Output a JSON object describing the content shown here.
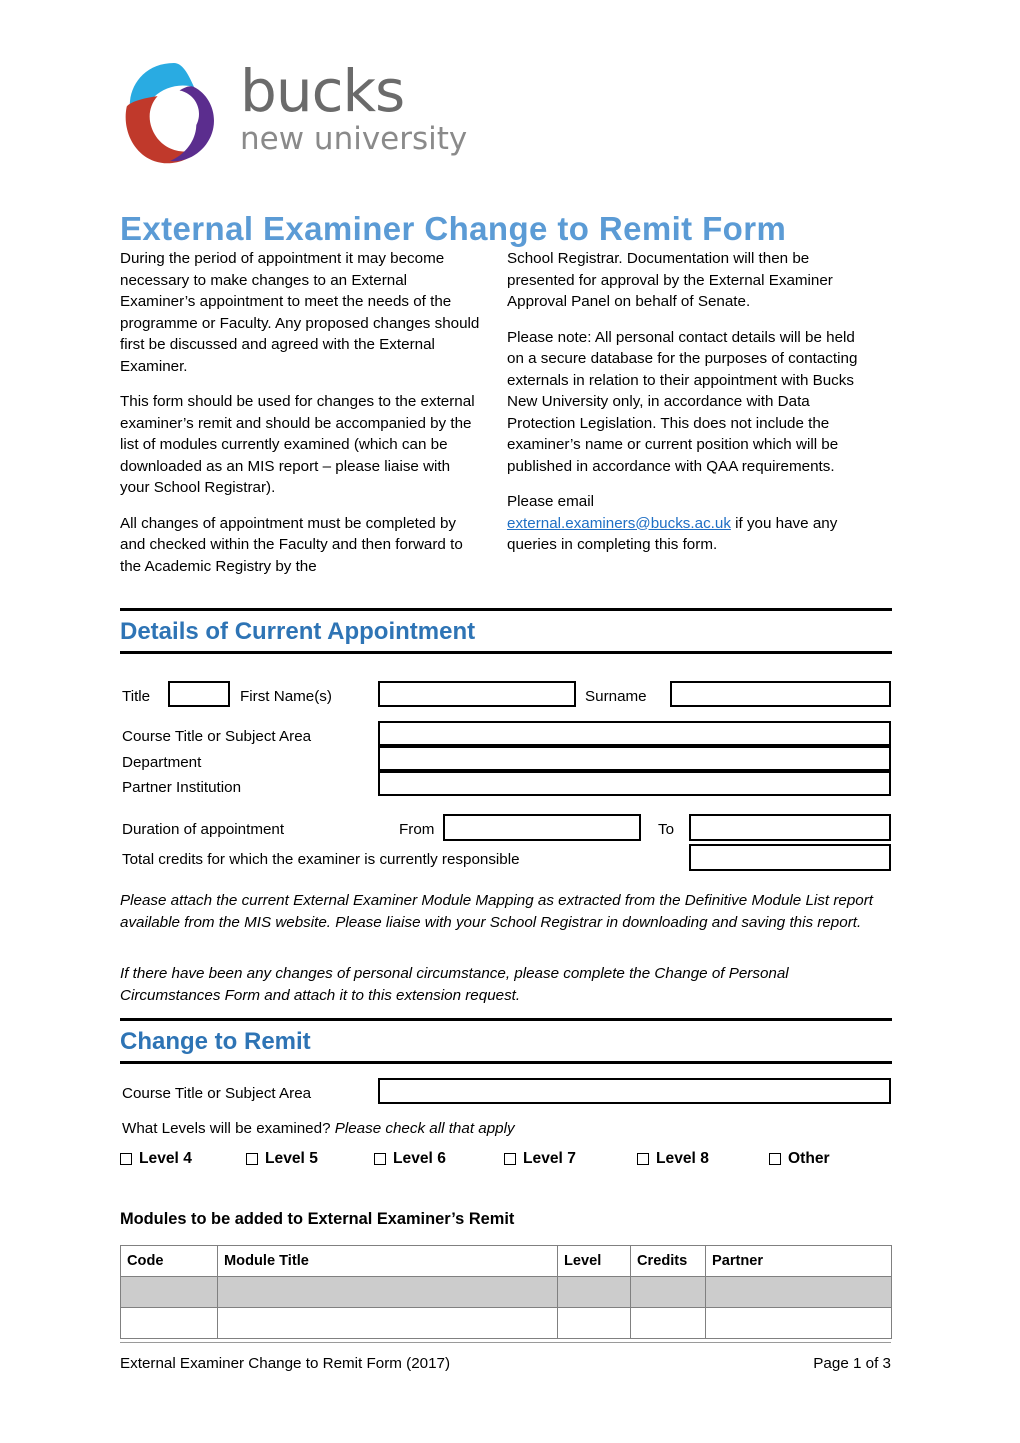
{
  "logo": {
    "word_top": "bucks",
    "word_bottom": "new university",
    "alt": "Bucks New University"
  },
  "document": {
    "title": "External Examiner Change to Remit Form"
  },
  "intro": {
    "left_column": [
      "During the period of appointment it may become necessary to make changes to an External Examiner’s appointment to meet the needs of the programme or Faculty. Any proposed changes should first be discussed and agreed with the External Examiner.",
      "This form should be used for changes to the external examiner’s remit and should be accompanied by the list of modules currently examined (which can be downloaded as an MIS report – please liaise with your School Registrar).",
      "All changes of appointment must be completed by and checked within the Faculty and then forward to the Academic Registry by the"
    ],
    "right_column": [
      "School Registrar. Documentation will then be presented for approval by the External Examiner Approval Panel on behalf of Senate.",
      "Please note: All personal contact details will be held on a secure database for the purposes of contacting externals in relation to their appointment with Bucks New University only, in accordance with Data Protection Legislation. This does not include the examiner’s name or current position which will be published in accordance with QAA requirements."
    ],
    "email_lead": "Please email",
    "email_address": "external.examiners@bucks.ac.uk",
    "email_trail": " if you have any queries in completing this form."
  },
  "section_current": {
    "heading": "Details of Current Appointment",
    "title_label": "Title",
    "title_value": "",
    "first_name_label": "First Name(s)",
    "first_name_value": "",
    "surname_label": "Surname",
    "surname_value": "",
    "course_label": "Course Title or Subject Area",
    "course_value": "",
    "department_label": "Department",
    "department_value": "",
    "partner_label": "Partner Institution",
    "partner_value": "",
    "duration_label": "Duration of appointment",
    "from_label": "From",
    "from_value": "",
    "to_label": "To",
    "to_value": "",
    "credits_label": "Total credits for which the examiner is currently responsible",
    "credits_value": ""
  },
  "notes": {
    "attach_note": "Please attach the current External Examiner Module Mapping as extracted from the Definitive Module List report available from the MIS website. Please liaise with your School Registrar in downloading and saving this report.",
    "circumstances_note": "If there have been any changes of personal circumstance, please complete the Change of Personal Circumstances Form and attach it to this extension request."
  },
  "section_change": {
    "heading": "Change to Remit",
    "course_label": "Course Title or Subject Area",
    "course_value": "",
    "levels_question": "What Levels will be examined? ",
    "levels_question_italic": "Please check all that apply",
    "levels": [
      {
        "label": "Level 4",
        "checked": false
      },
      {
        "label": "Level 5",
        "checked": false
      },
      {
        "label": "Level 6",
        "checked": false
      },
      {
        "label": "Level 7",
        "checked": false
      },
      {
        "label": "Level 8",
        "checked": false
      },
      {
        "label": "Other",
        "checked": false
      }
    ]
  },
  "modules": {
    "heading": "Modules to be added to External Examiner’s Remit",
    "columns": [
      "Code",
      "Module Title",
      "Level",
      "Credits",
      "Partner"
    ],
    "rows": [
      {
        "shaded": true,
        "cells": [
          "",
          "",
          "",
          "",
          ""
        ]
      },
      {
        "shaded": false,
        "cells": [
          "",
          "",
          "",
          "",
          ""
        ]
      }
    ]
  },
  "footer": {
    "left": "External Examiner Change to Remit Form (2017)",
    "right": "Page 1 of 3"
  },
  "colors": {
    "title_blue": "#5b9bd5",
    "heading_blue": "#2e74b5",
    "link_blue": "#1f6fc4",
    "shaded_row": "#cccccc",
    "table_border": "#808080",
    "logo_red": "#c0392b",
    "logo_blue": "#29abe2",
    "logo_purple": "#5b2d8e",
    "logo_grey": "#6b6b6b"
  }
}
